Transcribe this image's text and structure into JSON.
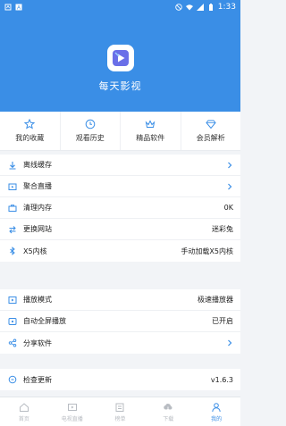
{
  "status_bar": {
    "time": "1:33"
  },
  "header": {
    "app_name": "每天影视"
  },
  "quick_actions": [
    {
      "label": "我的收藏",
      "icon": "star-icon"
    },
    {
      "label": "观看历史",
      "icon": "clock-icon"
    },
    {
      "label": "精品软件",
      "icon": "crown-icon"
    },
    {
      "label": "会员解析",
      "icon": "diamond-icon"
    }
  ],
  "group1": [
    {
      "label": "离线缓存",
      "icon": "download-icon",
      "value": "",
      "chevron": true
    },
    {
      "label": "聚合直播",
      "icon": "tv-icon",
      "value": "",
      "chevron": true
    },
    {
      "label": "清理内存",
      "icon": "briefcase-icon",
      "value": "0K",
      "chevron": false
    },
    {
      "label": "更换网站",
      "icon": "swap-icon",
      "value": "迷彩兔",
      "chevron": false
    },
    {
      "label": "X5内核",
      "icon": "bluetooth-icon",
      "value": "手动加载X5内核",
      "chevron": false
    }
  ],
  "group2": [
    {
      "label": "播放模式",
      "icon": "play-mode-icon",
      "value": "极速播放器",
      "chevron": false
    },
    {
      "label": "自动全屏播放",
      "icon": "fullscreen-icon",
      "value": "已开启",
      "chevron": false
    },
    {
      "label": "分享软件",
      "icon": "share-icon",
      "value": "",
      "chevron": true
    }
  ],
  "group3": [
    {
      "label": "检查更新",
      "icon": "update-icon",
      "value": "v1.6.3",
      "chevron": false
    }
  ],
  "tabs": [
    {
      "label": "首页",
      "icon": "home-icon",
      "active": false
    },
    {
      "label": "电视直播",
      "icon": "live-tv-icon",
      "active": false
    },
    {
      "label": "榜单",
      "icon": "ranking-icon",
      "active": false
    },
    {
      "label": "下载",
      "icon": "cloud-download-icon",
      "active": false
    },
    {
      "label": "我的",
      "icon": "user-icon",
      "active": true
    }
  ],
  "colors": {
    "accent": "#3a8ee6",
    "inactive": "#b8bcc2"
  }
}
